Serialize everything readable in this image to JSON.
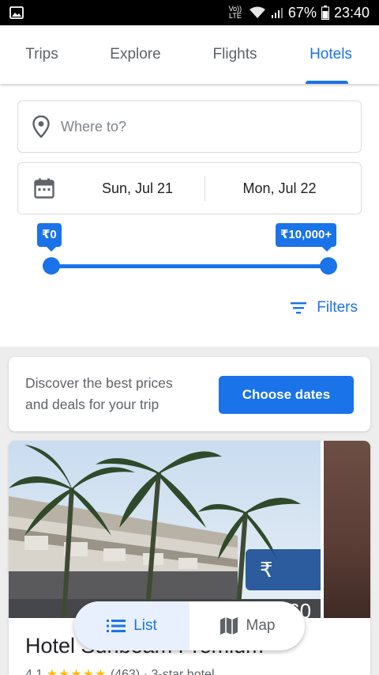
{
  "status_bar": {
    "network_label": "Vo)) LTE",
    "battery": "67%",
    "time": "23:40"
  },
  "tabs": [
    {
      "label": "Trips",
      "active": false
    },
    {
      "label": "Explore",
      "active": false
    },
    {
      "label": "Flights",
      "active": false
    },
    {
      "label": "Hotels",
      "active": true
    }
  ],
  "search": {
    "destination_placeholder": "Where to?",
    "check_in": "Sun, Jul 21",
    "check_out": "Mon, Jul 22"
  },
  "price_range": {
    "min_label": "₹0",
    "max_label": "₹10,000+",
    "min_fraction": 0,
    "max_fraction": 1
  },
  "filters": {
    "label": "Filters"
  },
  "discover": {
    "text": "Discover the best prices and deals for your trip",
    "button_label": "Choose dates"
  },
  "hotel": {
    "price": "₹ 3,660",
    "name": "Hotel Sunbeam Premium",
    "rating": "4.1",
    "stars": "★★★★★",
    "reviews": "(463)",
    "class": "· 3-star hotel"
  },
  "view_toggle": {
    "list_label": "List",
    "map_label": "Map",
    "active": "list"
  },
  "colors": {
    "accent": "#1a73e8",
    "star": "#fbbc04"
  }
}
